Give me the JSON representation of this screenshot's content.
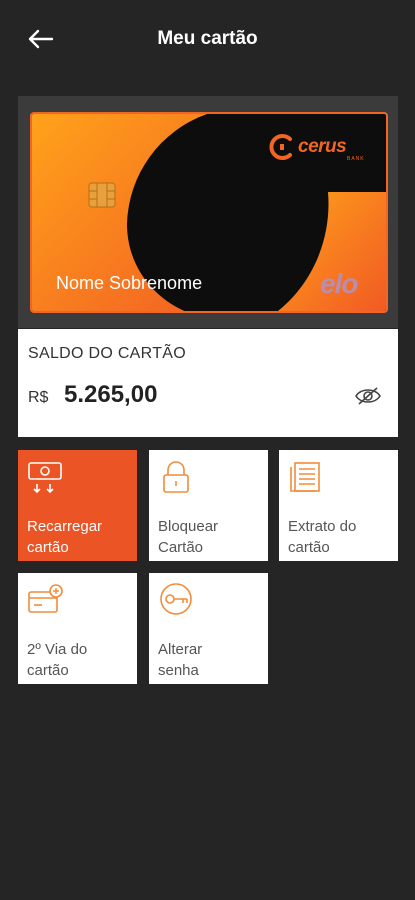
{
  "header": {
    "title": "Meu cartão",
    "back_icon": "arrow-left-icon"
  },
  "card": {
    "holder_name": "Nome Sobrenome",
    "brand_name": "cerus",
    "brand_sub": "BANK",
    "network": "elo",
    "accent_color": "#f26522"
  },
  "balance": {
    "label": "SALDO DO CARTÃO",
    "currency": "R$",
    "amount": "5.265,00",
    "toggle_icon": "eye-off-icon"
  },
  "actions": [
    {
      "label_1": "Recarregar",
      "label_2": "cartão",
      "icon": "money-icon",
      "active": true
    },
    {
      "label_1": "Bloquear",
      "label_2": "Cartão",
      "icon": "lock-icon",
      "active": false
    },
    {
      "label_1": "Extrato do",
      "label_2": "cartão",
      "icon": "document-icon",
      "active": false
    },
    {
      "label_1": "2º Via do",
      "label_2": "cartão",
      "icon": "card-copy-icon",
      "active": false
    },
    {
      "label_1": "Alterar",
      "label_2": "senha",
      "icon": "key-icon",
      "active": false
    }
  ]
}
